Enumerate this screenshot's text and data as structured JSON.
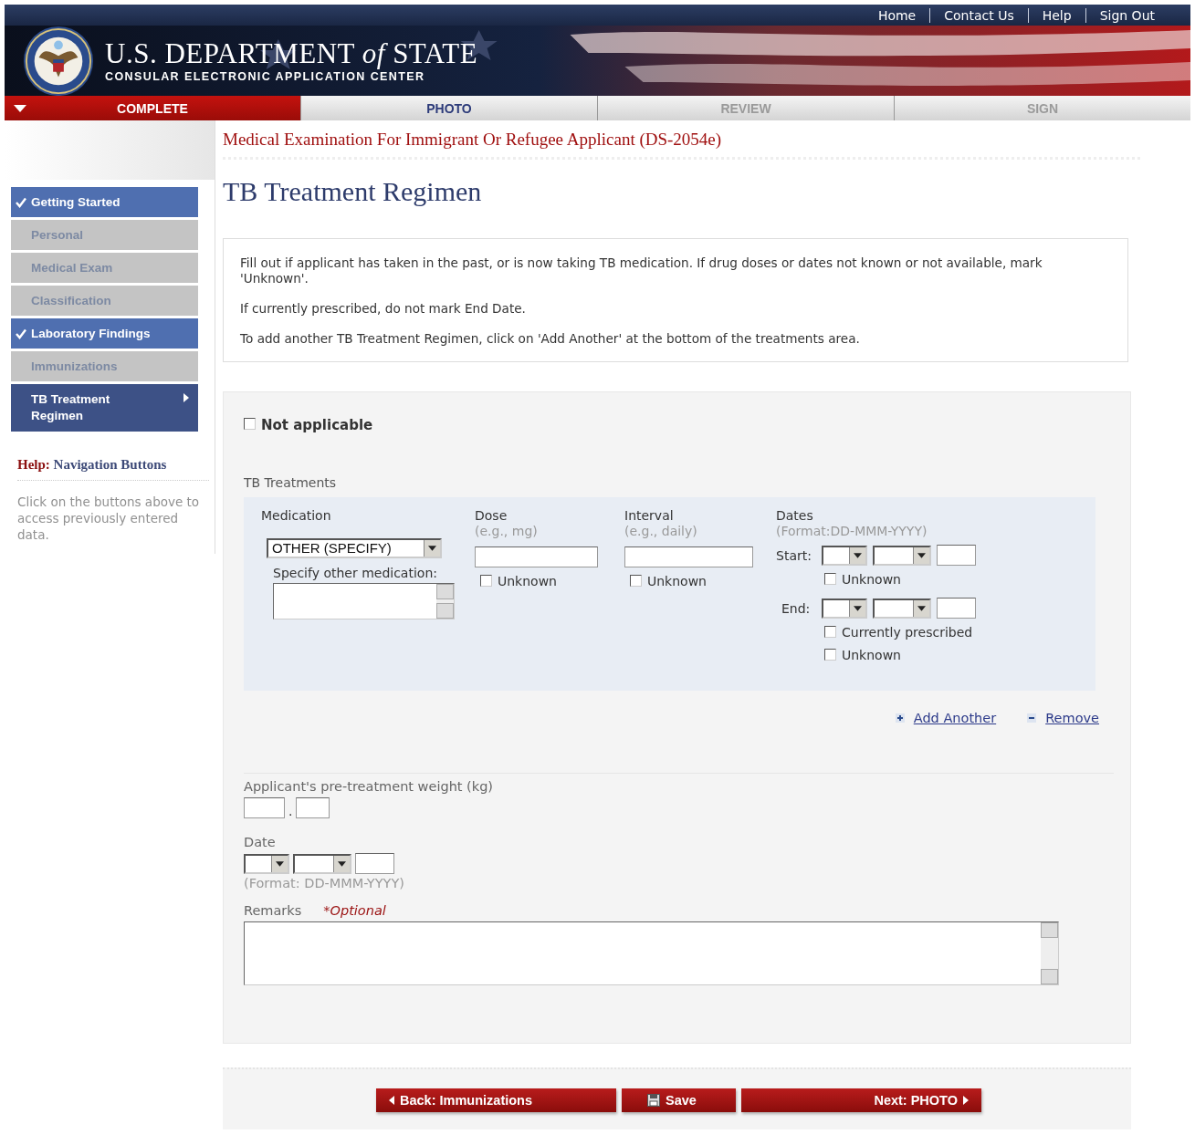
{
  "top_links": [
    "Home",
    "Contact Us",
    "Help",
    "Sign Out"
  ],
  "banner": {
    "title": "U.S. DEPARTMENT *of* STATE",
    "subtitle": "CONSULAR ELECTRONIC APPLICATION CENTER"
  },
  "steps": [
    {
      "label": "COMPLETE",
      "selected": true,
      "disabled": false
    },
    {
      "label": "PHOTO",
      "selected": false,
      "disabled": false
    },
    {
      "label": "REVIEW",
      "selected": false,
      "disabled": true
    },
    {
      "label": "SIGN",
      "selected": false,
      "disabled": true
    }
  ],
  "sidebar": {
    "items": [
      {
        "label": "Getting Started",
        "checked": true,
        "selected": false
      },
      {
        "label": "Personal",
        "checked": false,
        "selected": false
      },
      {
        "label": "Medical Exam",
        "checked": false,
        "selected": false
      },
      {
        "label": "Classification",
        "checked": false,
        "selected": false
      },
      {
        "label": "Laboratory Findings",
        "checked": true,
        "selected": false
      },
      {
        "label": "Immunizations",
        "checked": false,
        "selected": false
      },
      {
        "label": "TB Treatment Regimen",
        "checked": false,
        "selected": true
      }
    ],
    "help": {
      "label": "Help:",
      "topic": "Navigation Buttons",
      "text": "Click on the buttons above to access previously entered data."
    }
  },
  "form_title": "Medical Examination For Immigrant Or Refugee Applicant (DS-2054e)",
  "heading": "TB Treatment Regimen",
  "instructions": [
    "Fill out if applicant has taken in the past, or is now taking TB medication. If drug doses or dates not known or not available, mark 'Unknown'.",
    "If currently prescribed, do not mark End Date.",
    "To add another TB Treatment Regimen, click on 'Add Another' at the bottom of the treatments area."
  ],
  "not_applicable": {
    "label": "Not applicable",
    "checked": false
  },
  "treatments": {
    "label": "TB Treatments",
    "medication": {
      "label": "Medication",
      "value": "OTHER (SPECIFY)",
      "other_label": "Specify other medication:"
    },
    "dose": {
      "label": "Dose",
      "hint": "(e.g., mg)",
      "unknown": {
        "label": "Unknown",
        "checked": false
      }
    },
    "interval": {
      "label": "Interval",
      "hint": "(e.g., daily)",
      "unknown": {
        "label": "Unknown",
        "checked": false
      }
    },
    "dates": {
      "label": "Dates",
      "hint": "(Format:DD-MMM-YYYY)",
      "start": {
        "label": "Start:",
        "unknown": {
          "label": "Unknown",
          "checked": false
        }
      },
      "end": {
        "label": "End:",
        "currently_prescribed": {
          "label": "Currently prescribed",
          "checked": false
        },
        "unknown": {
          "label": "Unknown",
          "checked": false
        }
      }
    },
    "links": [
      {
        "kind": "add",
        "label": "Add Another"
      },
      {
        "kind": "remove",
        "label": "Remove"
      }
    ]
  },
  "weight": {
    "label": "Applicant's pre-treatment weight (kg)",
    "separator": "."
  },
  "date": {
    "label": "Date",
    "hint": "(Format: DD-MMM-YYYY)"
  },
  "remarks": {
    "label": "Remarks",
    "optional": "*Optional"
  },
  "buttons": [
    {
      "kind": "back",
      "label": "Back: Immunizations"
    },
    {
      "kind": "save",
      "label": "Save"
    },
    {
      "kind": "next",
      "label": "Next: PHOTO"
    }
  ]
}
